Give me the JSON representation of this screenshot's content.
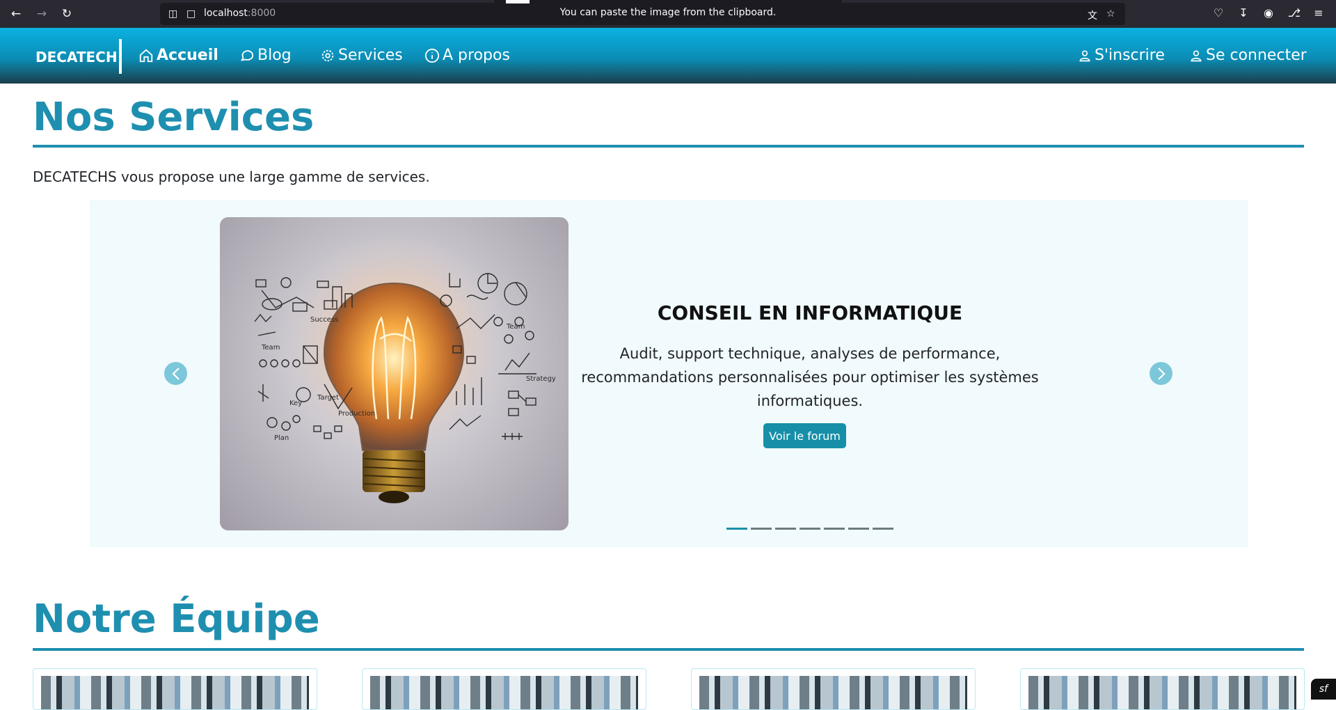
{
  "browser": {
    "url_host": "localhost",
    "url_port": ":8000",
    "toast": "You can paste the image from the clipboard."
  },
  "site": {
    "brand": "DECATECH",
    "nav": [
      {
        "label": "Accueil",
        "icon": "home-icon",
        "active": true
      },
      {
        "label": "Blog",
        "icon": "chat-bubble-icon",
        "active": false
      },
      {
        "label": "Services",
        "icon": "gear-icon",
        "active": false
      },
      {
        "label": "A propos",
        "icon": "info-icon",
        "active": false
      }
    ],
    "auth": [
      {
        "label": "S'inscrire",
        "icon": "user-icon"
      },
      {
        "label": "Se connecter",
        "icon": "user-icon"
      }
    ]
  },
  "services": {
    "title": "Nos Services",
    "intro": "DECATECHS vous propose une large gamme de services.",
    "slide": {
      "title": "CONSEIL EN INFORMATIQUE",
      "text": "Audit, support technique, analyses de performance, recommandations personnalisées pour optimiser les systèmes informatiques.",
      "button": "Voir le forum",
      "doodles": [
        "Success",
        "Team",
        "Team",
        "Key",
        "Target",
        "Production",
        "Plan",
        "Strategy"
      ]
    },
    "indicators": 7,
    "active_indicator": 0
  },
  "team": {
    "title": "Notre Équipe"
  },
  "colors": {
    "accent": "#1f8fb0",
    "button": "#178fa8",
    "nav_top": "#0bb2e2",
    "nav_bottom": "#1a3f4c"
  }
}
